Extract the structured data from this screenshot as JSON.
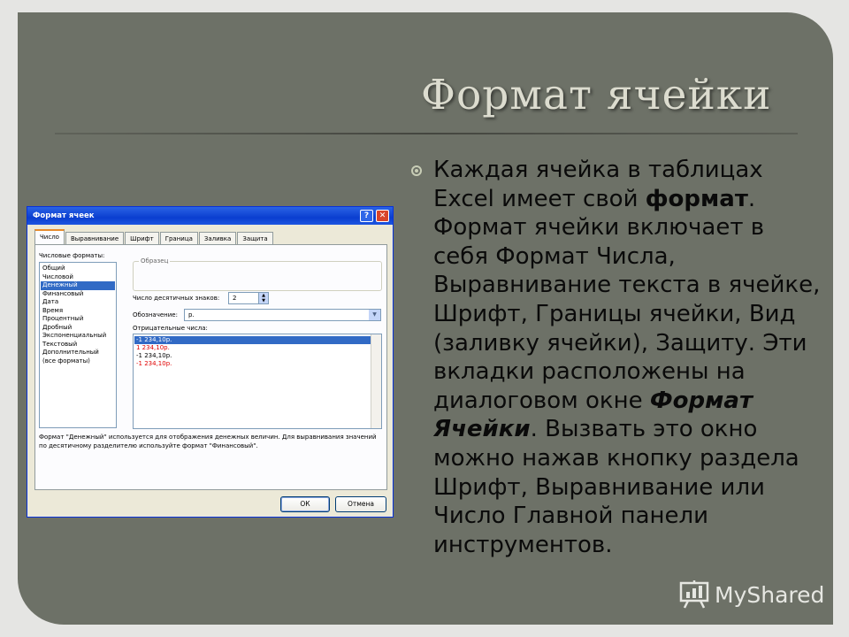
{
  "slide": {
    "title": "Формат ячейки",
    "body": {
      "p1": "Каждая ячейка в таблицах ",
      "excel": "Excel",
      "p2": " имеет свой ",
      "format_bold": "формат",
      "p3": ". Формат ячейки включает в себя Формат Числа, Выравнивание текста в ячейке, Шрифт, Границы ячейки, Вид (заливку ячейки), Защиту. Эти вкладки расположены на диалоговом окне ",
      "dialog_name": "Формат Ячейки",
      "p4": ". Вызвать это окно можно нажав кнопку раздела Шрифт, Выравнивание или Число Главной панели инструментов."
    }
  },
  "dialog": {
    "title": "Формат ячеек",
    "help_glyph": "?",
    "close_glyph": "✕",
    "tabs": [
      "Число",
      "Выравнивание",
      "Шрифт",
      "Граница",
      "Заливка",
      "Защита"
    ],
    "formats_label": "Числовые форматы:",
    "formats": [
      "Общий",
      "Числовой",
      "Денежный",
      "Финансовый",
      "Дата",
      "Время",
      "Процентный",
      "Дробный",
      "Экспоненциальный",
      "Текстовый",
      "Дополнительный",
      "(все форматы)"
    ],
    "selected_format": "Денежный",
    "sample_label": "Образец",
    "decimals_label": "Число десятичных знаков:",
    "decimals_value": "2",
    "symbol_label": "Обозначение:",
    "symbol_value": "р.",
    "negative_label": "Отрицательные числа:",
    "negative_options": [
      "-1 234,10р.",
      "1 234,10р.",
      "-1 234,10р.",
      "-1 234,10р."
    ],
    "description": "Формат \"Денежный\" используется для отображения денежных величин. Для выравнивания значений по десятичному разделителю используйте формат \"Финансовый\".",
    "ok_label": "ОК",
    "cancel_label": "Отмена"
  },
  "watermark": {
    "text": "MyShared"
  },
  "colors": {
    "slide_bg": "#6d7167",
    "title": "#dcdccf",
    "dialog_title": "#0a3ed0",
    "selection": "#316ac5",
    "negative_red": "#e00000"
  }
}
